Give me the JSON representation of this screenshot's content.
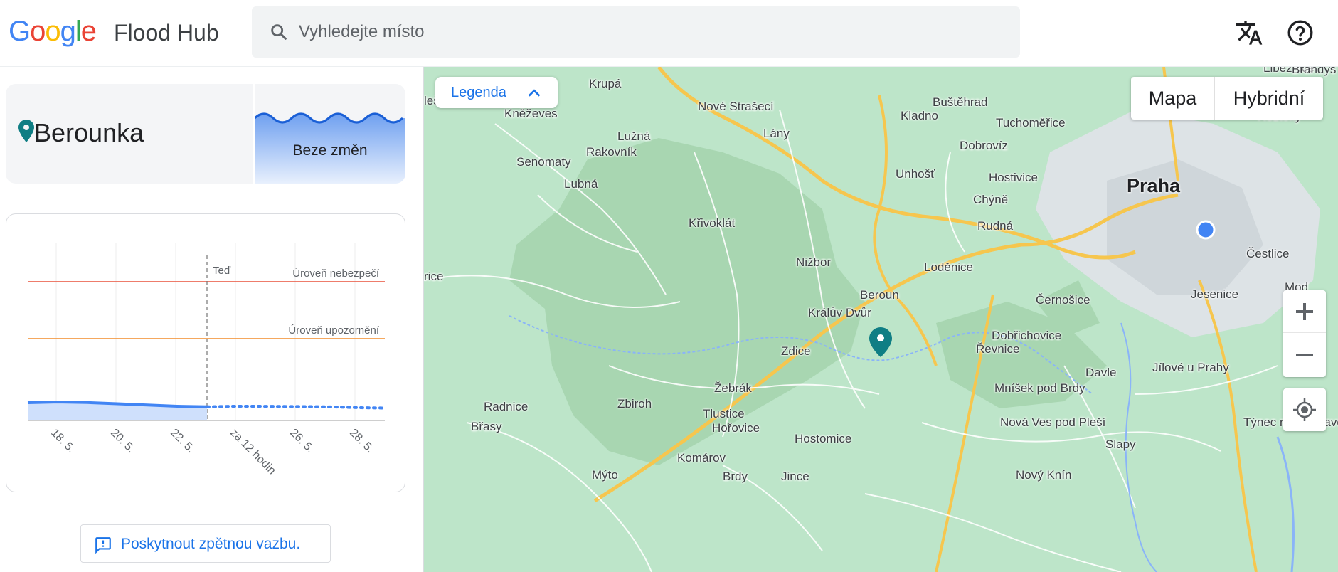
{
  "header": {
    "logo_text": "Google",
    "app_title": "Flood Hub",
    "search_placeholder": "Vyhledejte místo"
  },
  "gauge": {
    "river_name": "Berounka",
    "status": "Beze změn"
  },
  "chart_data": {
    "type": "area",
    "x_tick_labels": [
      "18. 5.",
      "20. 5.",
      "22. 5.",
      "za 12 hodin",
      "26. 5.",
      "28. 5."
    ],
    "thresholds": [
      {
        "name": "Úroveň nebezpečí",
        "level": 0.78
      },
      {
        "name": "Úroveň upozornění",
        "level": 0.46
      }
    ],
    "now_label": "Teď",
    "observed": [
      0.1,
      0.104,
      0.101,
      0.094,
      0.087,
      0.08,
      0.077
    ],
    "forecast": [
      0.077,
      0.08,
      0.08,
      0.079,
      0.078,
      0.076,
      0.072,
      0.07
    ],
    "ylim": [
      0,
      1
    ],
    "grid": true,
    "colors": {
      "danger": "#e8513a",
      "warning": "#f28c28",
      "observed": "#4285f4",
      "fill": "#cfe0fc"
    }
  },
  "feedback": {
    "label": "Poskytnout zpětnou vazbu."
  },
  "map": {
    "legend_label": "Legenda",
    "map_types": [
      "Mapa",
      "Hybridní"
    ],
    "labels": [
      {
        "t": "Praha",
        "big": true
      },
      {
        "t": "Krupá"
      },
      {
        "t": "Nové Strašecí"
      },
      {
        "t": "Buštěhrad"
      },
      {
        "t": "Kladno"
      },
      {
        "t": "Tuchoměřice"
      },
      {
        "t": "Kněževes"
      },
      {
        "t": "Lužná"
      },
      {
        "t": "Lány"
      },
      {
        "t": "Dobrovíz"
      },
      {
        "t": "Rakovník"
      },
      {
        "t": "Senomaty"
      },
      {
        "t": "Unhošť"
      },
      {
        "t": "Hostivice"
      },
      {
        "t": "Lubná"
      },
      {
        "t": "Chýně"
      },
      {
        "t": "Křivoklát"
      },
      {
        "t": "Rudná"
      },
      {
        "t": "Nižbor"
      },
      {
        "t": "Loděnice"
      },
      {
        "t": "Beroun"
      },
      {
        "t": "Králův Dvůr"
      },
      {
        "t": "Černošice"
      },
      {
        "t": "Jesenice"
      },
      {
        "t": "Zdice"
      },
      {
        "t": "Dobřichovice"
      },
      {
        "t": "Řevnice"
      },
      {
        "t": "Davle"
      },
      {
        "t": "Jílové u Prahy"
      },
      {
        "t": "Žebrák"
      },
      {
        "t": "Zbiroh"
      },
      {
        "t": "Radnice"
      },
      {
        "t": "Tlustice"
      },
      {
        "t": "Mníšek pod Brdy"
      },
      {
        "t": "Hořovice"
      },
      {
        "t": "Břasy"
      },
      {
        "t": "Hostomice"
      },
      {
        "t": "Nová Ves pod Pleší"
      },
      {
        "t": "Týnec nad Sázavou"
      },
      {
        "t": "Slapy"
      },
      {
        "t": "Komárov"
      },
      {
        "t": "Mýto"
      },
      {
        "t": "Brdy"
      },
      {
        "t": "Jince"
      },
      {
        "t": "Nový Knín"
      },
      {
        "t": "Čestlice"
      },
      {
        "t": "Kle"
      },
      {
        "t": "Roztoky"
      },
      {
        "t": "Libeznice"
      },
      {
        "t": "Brandýs"
      },
      {
        "t": "lešov"
      },
      {
        "t": "rice"
      },
      {
        "t": "Mod"
      }
    ]
  }
}
